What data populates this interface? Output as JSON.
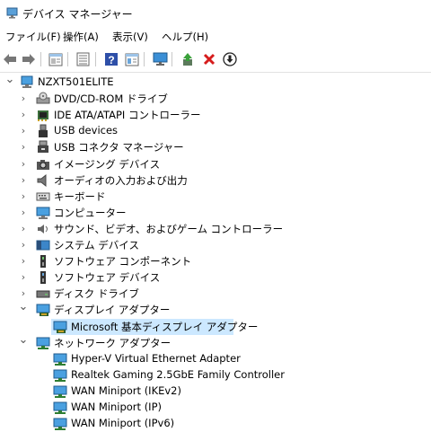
{
  "window": {
    "title": "デバイス マネージャー"
  },
  "menu": [
    "ファイル(F)",
    "操作(A)",
    "表示(V)",
    "ヘルプ(H)"
  ],
  "toolbar": {
    "buttons": [
      "back-arrow-icon",
      "forward-arrow-icon",
      "properties-view-icon",
      "list-view-icon",
      "help-icon",
      "details-icon",
      "monitor-scan-icon",
      "update-driver-icon",
      "uninstall-x-icon",
      "download-icon"
    ]
  },
  "tree": {
    "root": "NZXT501ELITE",
    "categories": [
      {
        "label": "DVD/CD-ROM ドライブ",
        "icon": "dvd-drive-icon",
        "expanded": false
      },
      {
        "label": "IDE ATA/ATAPI コントローラー",
        "icon": "ide-controller-icon",
        "expanded": false
      },
      {
        "label": "USB devices",
        "icon": "usb-device-icon",
        "expanded": false
      },
      {
        "label": "USB コネクタ マネージャー",
        "icon": "usb-connector-icon",
        "expanded": false
      },
      {
        "label": "イメージング デバイス",
        "icon": "camera-icon",
        "expanded": false
      },
      {
        "label": "オーディオの入力および出力",
        "icon": "speaker-icon",
        "expanded": false
      },
      {
        "label": "キーボード",
        "icon": "keyboard-icon",
        "expanded": false
      },
      {
        "label": "コンピューター",
        "icon": "computer-icon",
        "expanded": false
      },
      {
        "label": "サウンド、ビデオ、およびゲーム コントローラー",
        "icon": "sound-icon",
        "expanded": false
      },
      {
        "label": "システム デバイス",
        "icon": "system-device-icon",
        "expanded": false
      },
      {
        "label": "ソフトウェア コンポーネント",
        "icon": "software-component-icon",
        "expanded": false
      },
      {
        "label": "ソフトウェア デバイス",
        "icon": "software-device-icon",
        "expanded": false
      },
      {
        "label": "ディスク ドライブ",
        "icon": "disk-drive-icon",
        "expanded": false
      },
      {
        "label": "ディスプレイ アダプター",
        "icon": "display-adapter-icon",
        "expanded": true,
        "children": [
          {
            "label": "Microsoft 基本ディスプレイ アダプター",
            "icon": "display-adapter-icon",
            "selected": true
          }
        ]
      },
      {
        "label": "ネットワーク アダプター",
        "icon": "network-adapter-icon",
        "expanded": true,
        "children": [
          {
            "label": "Hyper-V Virtual Ethernet Adapter",
            "icon": "network-adapter-icon"
          },
          {
            "label": "Realtek Gaming 2.5GbE Family Controller",
            "icon": "network-adapter-icon"
          },
          {
            "label": "WAN Miniport (IKEv2)",
            "icon": "network-adapter-icon"
          },
          {
            "label": "WAN Miniport (IP)",
            "icon": "network-adapter-icon"
          },
          {
            "label": "WAN Miniport (IPv6)",
            "icon": "network-adapter-icon"
          }
        ]
      }
    ]
  }
}
